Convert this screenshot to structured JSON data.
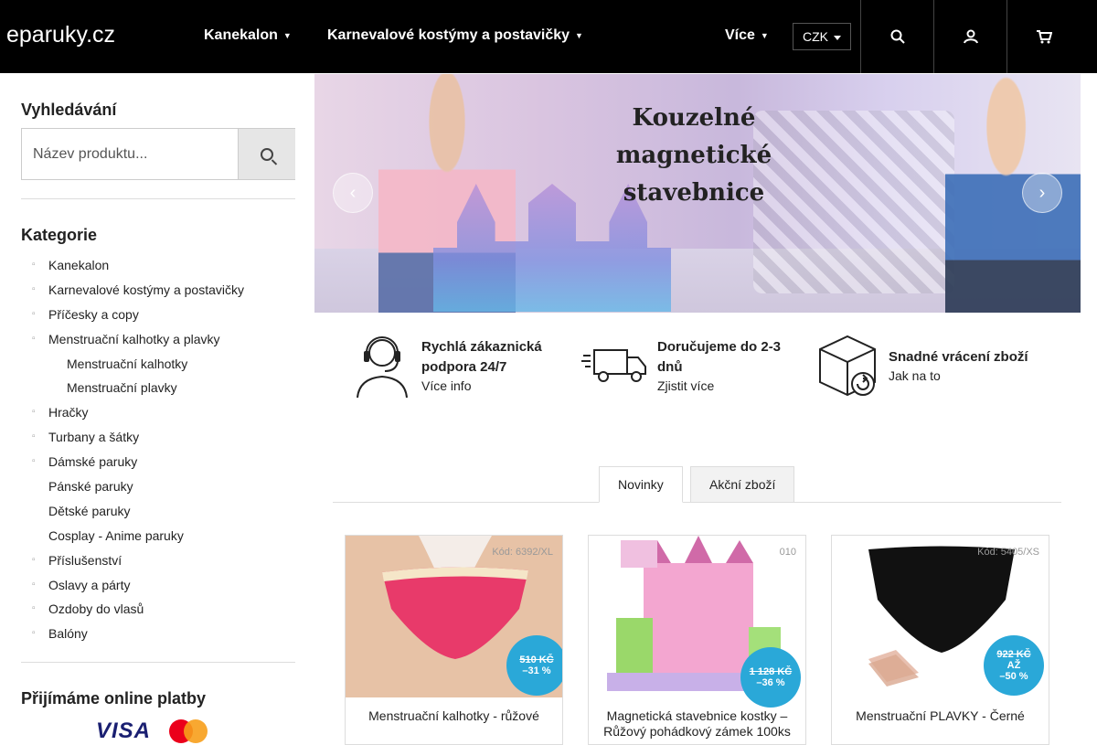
{
  "header": {
    "logo": "eparuky.cz",
    "nav": [
      {
        "label": "Kanekalon"
      },
      {
        "label": "Karnevalové kostýmy a postavičky"
      },
      {
        "label": "Více"
      }
    ],
    "currency": "CZK",
    "icons": [
      "search-icon",
      "user-icon",
      "cart-icon"
    ]
  },
  "sidebar": {
    "search_title": "Vyhledávání",
    "search_placeholder": "Název produktu...",
    "categories_title": "Kategorie",
    "categories": [
      "Kanekalon",
      "Karnevalové kostýmy a postavičky",
      "Příčesky a copy",
      "Menstruační kalhotky a plavky",
      "Menstruační kalhotky",
      "Menstruační plavky",
      "Hračky",
      "Turbany a šátky",
      "Dámské paruky",
      "Pánské paruky",
      "Dětské paruky",
      "Cosplay - Anime paruky",
      "Příslušenství",
      "Oslavy a párty",
      "Ozdoby do vlasů",
      "Balóny"
    ],
    "payments_title": "Přijímáme online platby",
    "payments": [
      "VISA",
      "mastercard"
    ]
  },
  "banner": {
    "title": "Kouzelné\nmagnetické\nstavebnice",
    "prev_icon": "chevron-left-icon",
    "next_icon": "chevron-right-icon"
  },
  "features": [
    {
      "icon": "headset-icon",
      "title": "Rychlá zákaznická podpora 24/7",
      "sub": "Více info"
    },
    {
      "icon": "delivery-truck-icon",
      "title": "Doručujeme do 2-3 dnů",
      "sub": "Zjistit více"
    },
    {
      "icon": "return-box-icon",
      "title": "Snadné vrácení zboží",
      "sub": "Jak na to"
    }
  ],
  "tabs": [
    {
      "label": "Novinky",
      "active": true
    },
    {
      "label": "Akční zboží",
      "active": false
    }
  ],
  "products": [
    {
      "code": "Kód: 6392/XL",
      "name": "Menstruační kalhotky - růžové",
      "old_price": "510 KČ",
      "discount": "–31 %"
    },
    {
      "code": "010",
      "name": "Magnetická stavebnice kostky – Růžový pohádkový zámek 100ks",
      "old_price": "1 128 KČ",
      "discount": "–36 %"
    },
    {
      "code": "Kód: 5405/XS",
      "name": "Menstruační PLAVKY - Černé",
      "old_price": "922 KČ",
      "prefix": "AŽ",
      "discount": "–50 %"
    }
  ],
  "colors": {
    "header_bg": "#000000",
    "badge": "#2aa8d8"
  }
}
